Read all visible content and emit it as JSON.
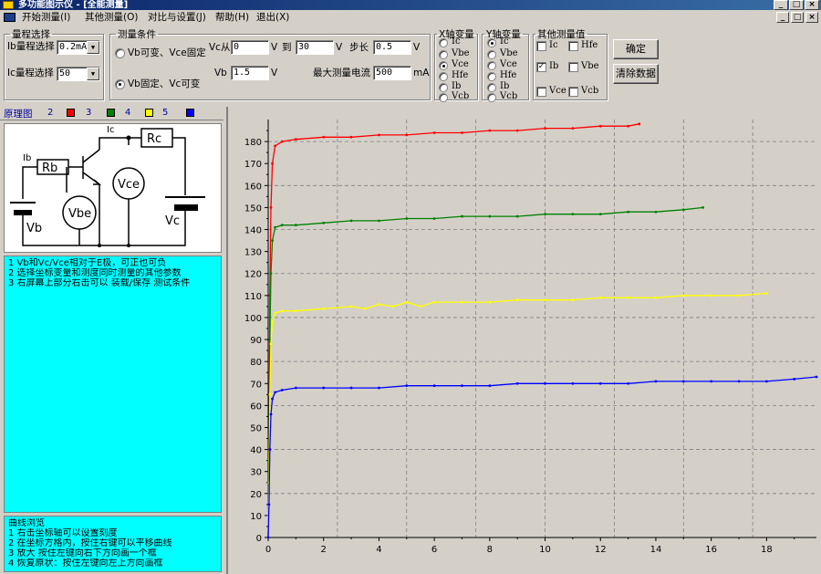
{
  "window": {
    "title": "多功能图示仪 - [全能测量]"
  },
  "menu": [
    {
      "label": "开始测量(I)"
    },
    {
      "label": "其他测量(O)"
    },
    {
      "label": "对比与设置(J)"
    },
    {
      "label": "帮助(H)"
    },
    {
      "label": "退出(X)"
    }
  ],
  "range_group": {
    "legend": "量程选择",
    "ib_label": "Ib量程选择",
    "ib_value": "0.2mA",
    "ic_label": "Ic量程选择",
    "ic_value": "50"
  },
  "conditions": {
    "legend": "测量条件",
    "option1": "Vb可变、Vce固定",
    "option2": "Vb固定、Vc可变",
    "vc_from_label": "Vc从",
    "vc_from_value": "0",
    "vc_from_unit": "V",
    "to_label": "到",
    "to_value": "30",
    "to_unit": "V",
    "step_label": "步长",
    "step_value": "0.5",
    "step_unit": "V",
    "vb_label": "Vb",
    "vb_value": "1.5",
    "vb_unit": "V",
    "maxcur_label": "最大测量电流",
    "maxcur_value": "500",
    "maxcur_unit": "mA"
  },
  "x_var": {
    "legend": "X轴变量",
    "options": [
      "Ic",
      "Vbe",
      "Vce",
      "Hfe",
      "Ib",
      "Vcb"
    ],
    "selected": 2
  },
  "y_var": {
    "legend": "Y轴变量",
    "options": [
      "Ic",
      "Vbe",
      "Vce",
      "Hfe",
      "Ib",
      "Vcb"
    ],
    "selected": 0
  },
  "other": {
    "legend": "其他测量值",
    "items": [
      {
        "label": "Ic",
        "checked": false
      },
      {
        "label": "Hfe",
        "checked": false
      },
      {
        "label": "Ib",
        "checked": true
      },
      {
        "label": "Vbe",
        "checked": false
      },
      {
        "label": "Vce",
        "checked": false
      },
      {
        "label": "Vcb",
        "checked": false
      }
    ]
  },
  "buttons": {
    "confirm": "确定",
    "clear": "清除数据"
  },
  "legend_strip": {
    "title": "原理图",
    "items": [
      {
        "num": "2",
        "color": "#ff0000"
      },
      {
        "num": "3",
        "color": "#008000"
      },
      {
        "num": "4",
        "color": "#ffff00"
      },
      {
        "num": "5",
        "color": "#0000ff"
      }
    ]
  },
  "circuit": {
    "ib": "Ib",
    "ic": "Ic",
    "rb": "Rb",
    "rc": "Rc",
    "vce": "Vce",
    "vbe": "Vbe",
    "vb": "Vb",
    "vc": "Vc"
  },
  "info1": [
    "1  Vb和Vc/Vce相对于E极，可正也可负",
    "2  选择坐标变量和测度同时测量的其他参数",
    "3  右屏幕上部分右击可以 装载/保存 测试条件"
  ],
  "info2": [
    "曲线浏览",
    "1  右击坐标轴可以设置刻度",
    "2  在坐标方格内，按住右键可以平移曲线",
    "3  放大  按住左键向右下方向画一个框",
    "4  恢复原状：按住左键向左上方向画框"
  ],
  "chart_data": {
    "type": "line",
    "xlim": [
      0,
      19.8
    ],
    "ylim": [
      0,
      190
    ],
    "x_ticks": [
      0,
      2,
      4,
      6,
      8,
      10,
      12,
      14,
      16,
      18
    ],
    "y_ticks": [
      0,
      10,
      20,
      30,
      40,
      50,
      60,
      70,
      80,
      90,
      100,
      110,
      120,
      130,
      140,
      150,
      160,
      170,
      180
    ],
    "grid": true,
    "series": [
      {
        "color": "#ff0000",
        "x": [
          0,
          0.03,
          0.06,
          0.1,
          0.15,
          0.25,
          0.5,
          1,
          2,
          3,
          4,
          5,
          6,
          7,
          8,
          9,
          10,
          11,
          12,
          13,
          13.4
        ],
        "y": [
          0,
          40,
          110,
          150,
          170,
          178,
          180,
          181,
          182,
          182,
          183,
          183,
          184,
          184,
          185,
          185,
          186,
          186,
          187,
          187,
          188
        ]
      },
      {
        "color": "#008000",
        "x": [
          0,
          0.03,
          0.06,
          0.1,
          0.15,
          0.25,
          0.5,
          1,
          2,
          3,
          4,
          5,
          6,
          7,
          8,
          9,
          10,
          11,
          12,
          13,
          14,
          15,
          15.7
        ],
        "y": [
          0,
          35,
          90,
          120,
          135,
          141,
          142,
          142,
          143,
          144,
          144,
          145,
          145,
          146,
          146,
          146,
          147,
          147,
          147,
          148,
          148,
          149,
          150
        ]
      },
      {
        "color": "#ffff00",
        "x": [
          0,
          0.03,
          0.06,
          0.1,
          0.15,
          0.25,
          0.5,
          1,
          2,
          3,
          3.5,
          4,
          4.5,
          5,
          5.5,
          6,
          7,
          8,
          9,
          10,
          11,
          12,
          13,
          14,
          15,
          16,
          17,
          18
        ],
        "y": [
          0,
          25,
          65,
          88,
          98,
          102,
          103,
          103,
          104,
          105,
          104,
          106,
          105,
          107,
          105,
          107,
          107,
          107,
          108,
          108,
          108,
          109,
          109,
          109,
          110,
          110,
          110,
          111
        ]
      },
      {
        "color": "#0000ff",
        "x": [
          0,
          0.03,
          0.06,
          0.1,
          0.15,
          0.25,
          0.5,
          1,
          2,
          3,
          4,
          5,
          6,
          7,
          8,
          9,
          10,
          11,
          12,
          13,
          14,
          15,
          16,
          17,
          18,
          19,
          19.8
        ],
        "y": [
          0,
          15,
          40,
          56,
          63,
          66,
          67,
          68,
          68,
          68,
          68,
          69,
          69,
          69,
          69,
          70,
          70,
          70,
          70,
          70,
          71,
          71,
          71,
          71,
          71,
          72,
          73
        ]
      }
    ]
  }
}
